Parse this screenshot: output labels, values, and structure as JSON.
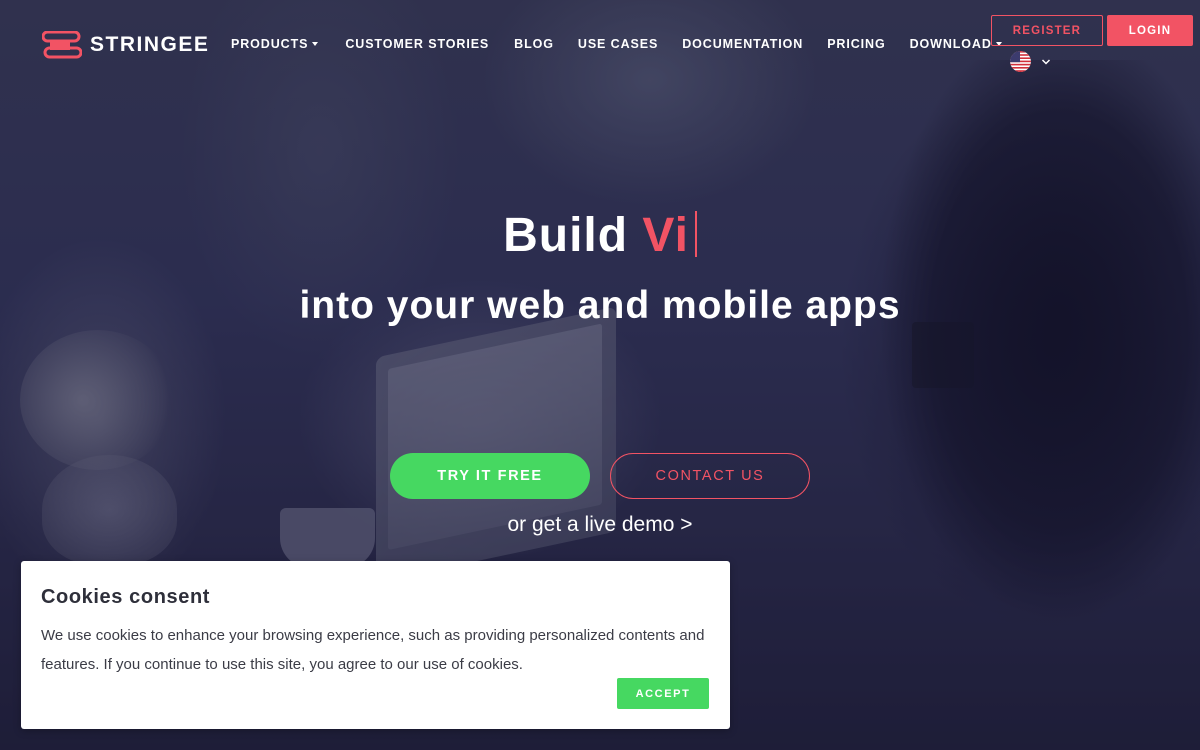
{
  "brand": {
    "name": "STRINGEE",
    "accent_color": "#f25364",
    "success_color": "#46d861"
  },
  "nav": {
    "items": [
      {
        "label": "PRODUCTS",
        "has_dropdown": true
      },
      {
        "label": "CUSTOMER STORIES",
        "has_dropdown": false
      },
      {
        "label": "BLOG",
        "has_dropdown": false
      },
      {
        "label": "USE CASES",
        "has_dropdown": false
      },
      {
        "label": "DOCUMENTATION",
        "has_dropdown": false
      },
      {
        "label": "PRICING",
        "has_dropdown": false
      },
      {
        "label": "DOWNLOAD",
        "has_dropdown": true
      }
    ],
    "register_label": "REGISTER",
    "login_label": "LOGIN",
    "language_icon": "us-flag-icon"
  },
  "hero": {
    "title_prefix": "Build",
    "title_typed": "Vi",
    "subtitle": "into your web and mobile apps",
    "try_label": "TRY IT FREE",
    "contact_label": "CONTACT US",
    "demo_label": "or get a live demo >"
  },
  "cookie": {
    "title": "Cookies consent",
    "text": "We use cookies to enhance your browsing experience, such as providing personalized contents and features. If you continue to use this site, you agree to our use of cookies.",
    "accept_label": "ACCEPT"
  }
}
